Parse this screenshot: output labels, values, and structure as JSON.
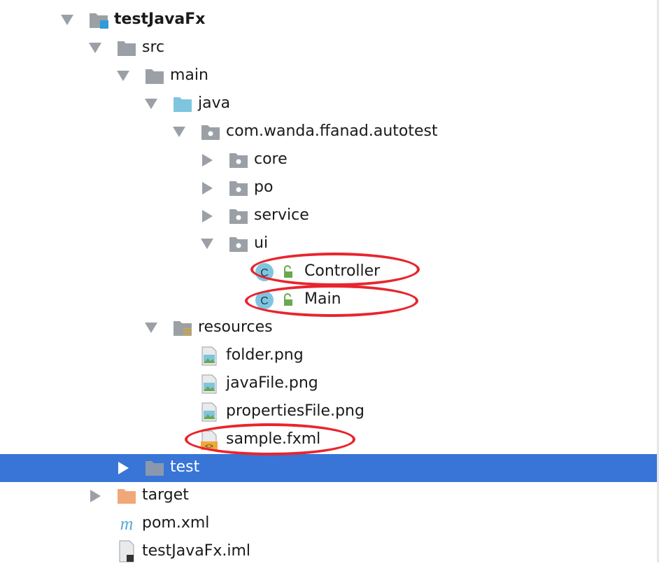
{
  "tree": {
    "project": "testJavaFx",
    "src": "src",
    "main": "main",
    "java": "java",
    "package": "com.wanda.ffanad.autotest",
    "core": "core",
    "po": "po",
    "service": "service",
    "ui": "ui",
    "controller": "Controller",
    "main_class": "Main",
    "resources": "resources",
    "folder_png": "folder.png",
    "javafile_png": "javaFile.png",
    "propertiesfile_png": "propertiesFile.png",
    "sample_fxml": "sample.fxml",
    "test": "test",
    "target": "target",
    "pom": "pom.xml",
    "iml": "testJavaFx.iml"
  },
  "icons": {
    "class_letter": "C",
    "maven_letter": "m",
    "fxml_glyph": "<>"
  },
  "colors": {
    "selection": "#3875d7",
    "annotation": "#e8252d",
    "folder": "#9aa0a6",
    "source_folder": "#7fc5e0",
    "target_folder": "#f0a878"
  }
}
